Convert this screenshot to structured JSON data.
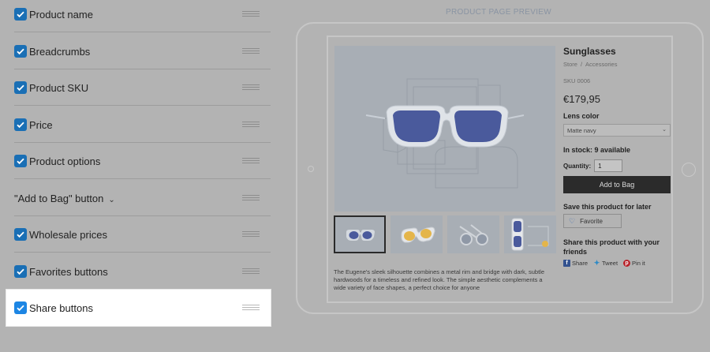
{
  "settings": {
    "items": [
      {
        "label": "Product name",
        "checked": true
      },
      {
        "label": "Breadcrumbs",
        "checked": true
      },
      {
        "label": "Product SKU",
        "checked": true
      },
      {
        "label": "Price",
        "checked": true
      },
      {
        "label": "Product options",
        "checked": true
      },
      {
        "label": "\"Add to Bag\" button",
        "checked": false,
        "expandable": true
      },
      {
        "label": "Wholesale prices",
        "checked": true
      },
      {
        "label": "Favorites buttons",
        "checked": true
      },
      {
        "label": "Share buttons",
        "checked": true,
        "highlighted": true
      }
    ]
  },
  "preview": {
    "title": "PRODUCT PAGE PREVIEW",
    "product": {
      "name": "Sunglasses",
      "breadcrumb": [
        "Store",
        "Accessories"
      ],
      "breadcrumb_sep": "/",
      "sku": "SKU 0006",
      "price": "€179,95",
      "option_label": "Lens color",
      "option_value": "Matte navy",
      "stock": "In stock: 9 available",
      "quantity_label": "Quantity:",
      "quantity_value": "1",
      "add_button": "Add to Bag",
      "save_label": "Save this product for later",
      "favorite_button": "Favorite",
      "share_label": "Share this product with your friends",
      "share_buttons": [
        "Share",
        "Tweet",
        "Pin it"
      ],
      "description": "The Eugene's sleek silhouette combines a metal rim and bridge with dark, subtle hardwoods for a timeless and refined look. The simple aesthetic complements a wide variety of face shapes, a perfect choice for anyone"
    }
  },
  "colors": {
    "accent": "#1a6fb5",
    "checkbox_highlight": "#1d86e4",
    "lens": "#4a5a9c",
    "add_button_bg": "#2b2b2b"
  }
}
